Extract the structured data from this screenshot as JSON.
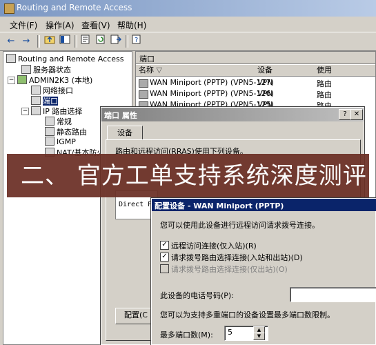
{
  "window": {
    "title": "Routing and Remote Access"
  },
  "menu": [
    "文件(F)",
    "操作(A)",
    "查看(V)",
    "帮助(H)"
  ],
  "toolbar": {
    "back": "←",
    "forward": "→"
  },
  "tree": {
    "root": "Routing and Remote Access",
    "status": "服务器状态",
    "server": "ADMIN2K3 (本地)",
    "netif": "网络接口",
    "ports": "端口",
    "iprouting": "IP 路由选择",
    "general": "常规",
    "static": "静态路由",
    "igmp": "IGMP",
    "nat": "NAT/基本防火"
  },
  "ports_pane": {
    "header": "端口",
    "columns": [
      "名称",
      "设备",
      "使用"
    ],
    "rows": [
      {
        "name": "WAN Miniport (PPTP) (VPN5-127)",
        "device": "VPN",
        "use": "路由"
      },
      {
        "name": "WAN Miniport (PPTP) (VPN5-126)",
        "device": "VPN",
        "use": "路由"
      },
      {
        "name": "WAN Miniport (PPTP) (VPN5-125)",
        "device": "VPN",
        "use": "路由"
      }
    ]
  },
  "port_props": {
    "title": "端口 属性",
    "tab": "设备",
    "desc": "路由和远程访问(RRAS)使用下列设备。",
    "list_item": "Direct P",
    "config_button": "配置(C"
  },
  "banner": {
    "text": "二、 官方工单支持系统深度测评"
  },
  "config_device": {
    "title": "配置设备 - WAN Miniport (PPTP)",
    "intro": "您可以使用此设备进行远程访问请求拨号连接。",
    "cb1": "远程访问连接(仅入站)(R)",
    "cb2": "请求拨号路由选择连接(入站和出站)(D)",
    "cb3": "请求拨号路由选择连接(仅出站)(O)",
    "phone_label": "此设备的电话号码(P):",
    "phone_value": "",
    "limit_text": "您可以为支持多重端口的设备设置最多端口数限制。",
    "max_label": "最多端口数(M):",
    "max_value": "5"
  }
}
